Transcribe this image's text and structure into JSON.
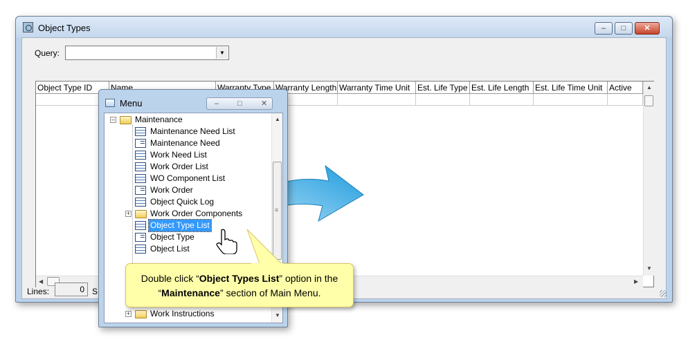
{
  "main_window": {
    "title": "Object Types",
    "minimize": "–",
    "maximize": "□",
    "close": "✕"
  },
  "query": {
    "label": "Query:",
    "value": "",
    "arrow": "▼"
  },
  "grid": {
    "columns": [
      "Object Type ID",
      "Name",
      "Warranty Type",
      "Warranty Length",
      "Warranty Time Unit",
      "Est. Life Type",
      "Est. Life Length",
      "Est. Life Time Unit",
      "Active"
    ]
  },
  "status": {
    "lines_label": "Lines:",
    "lines_value": "0",
    "s_label": "S"
  },
  "menu_window": {
    "title": "Menu",
    "minimize": "–",
    "maximize": "□",
    "close": "✕",
    "tree": [
      {
        "label": "Maintenance",
        "type": "folder",
        "expander": "–"
      },
      {
        "label": "Maintenance Need List",
        "type": "list"
      },
      {
        "label": "Maintenance Need",
        "type": "form"
      },
      {
        "label": "Work Need List",
        "type": "list"
      },
      {
        "label": "Work Order List",
        "type": "list"
      },
      {
        "label": "WO Component List",
        "type": "list"
      },
      {
        "label": "Work Order",
        "type": "form"
      },
      {
        "label": "Object Quick Log",
        "type": "list"
      },
      {
        "label": "Work Order Components",
        "type": "folder",
        "expander": "+"
      },
      {
        "label": "Object Type List",
        "type": "list",
        "selected": true
      },
      {
        "label": "Object Type",
        "type": "form"
      },
      {
        "label": "Object List",
        "type": "list"
      },
      {
        "label": "Work Instructions",
        "type": "folder",
        "expander": "+"
      }
    ]
  },
  "callout": {
    "prefix": "Double click “",
    "bold1": "Object Types List",
    "middle": "” option in the “",
    "bold2": "Maintenance",
    "suffix": "” section of Main Menu."
  }
}
